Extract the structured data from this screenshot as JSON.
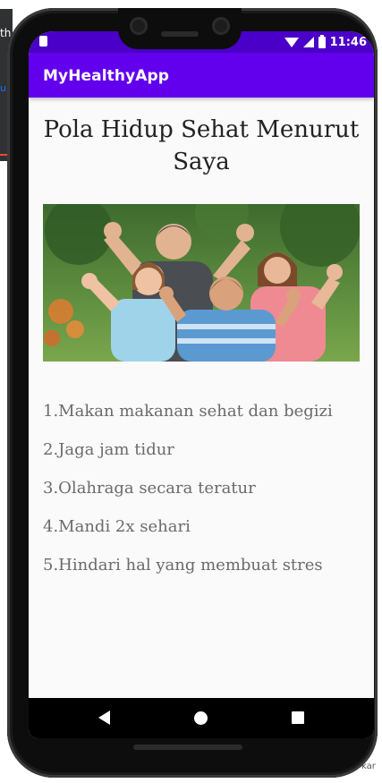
{
  "edge": {
    "left_text": "th",
    "left_accent": "u",
    "bottom_right_text": "kar"
  },
  "status_bar": {
    "time": "11:46",
    "icons": [
      "sim-card-icon",
      "wifi-icon",
      "cell-signal-icon",
      "battery-icon"
    ]
  },
  "app_bar": {
    "title": "MyHealthyApp",
    "color": "#6200ee",
    "status_color": "#4a00c8"
  },
  "content": {
    "heading": "Pola Hidup Sehat Menurut Saya",
    "image_subject": "family-photo",
    "items": [
      "1.Makan makanan sehat dan begizi",
      "2.Jaga jam tidur",
      "3.Olahraga secara teratur",
      "4.Mandi 2x sehari",
      "5.Hindari hal yang membuat stres"
    ]
  },
  "nav_bar": {
    "icons": [
      "back-icon",
      "home-icon",
      "recents-icon"
    ]
  }
}
